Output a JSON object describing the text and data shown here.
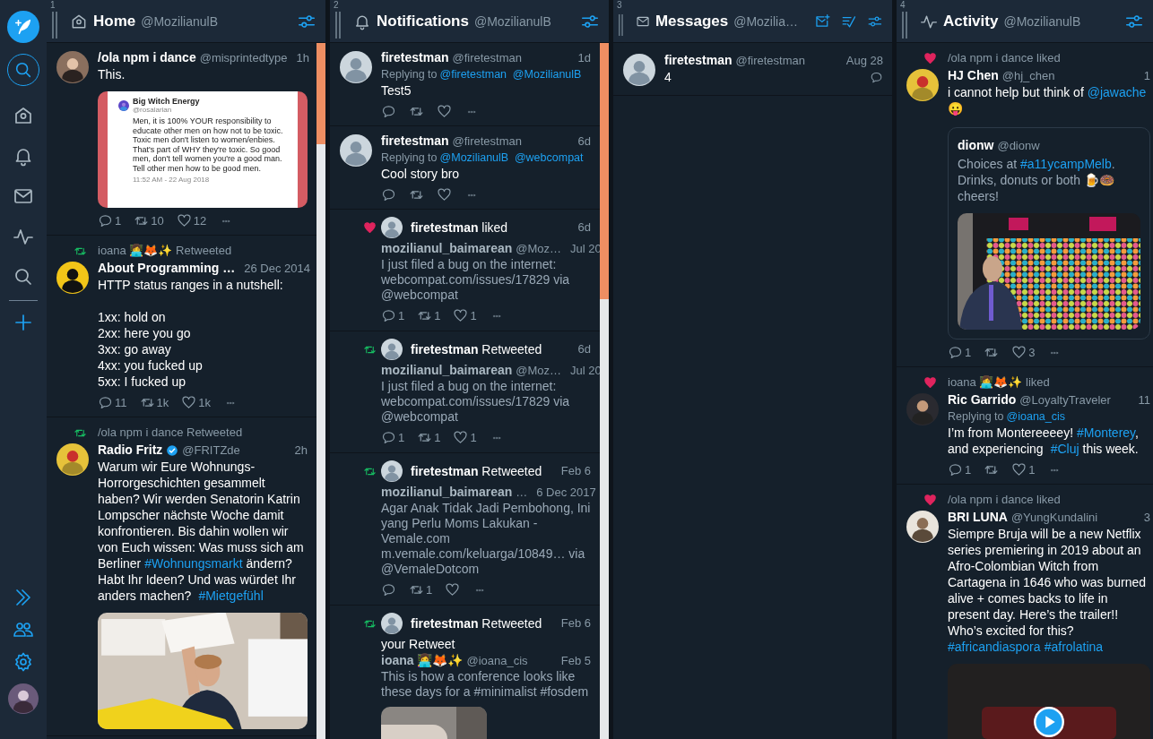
{
  "columns": [
    {
      "number": "1",
      "kind": "home",
      "title": "Home",
      "account": "@MozilianulB",
      "items": [
        {
          "kind": "tweet",
          "name": "/ola npm i dance",
          "handle": "@misprintedtype",
          "time": "1h",
          "verified": false,
          "text": [
            "This."
          ],
          "media": {
            "kind": "tweet_image",
            "author": "Big Witch Energy",
            "handle": "@rosalarian",
            "text": "Men, it is 100% YOUR responsibility to educate other men on how not to be toxic. Toxic men don't listen to women/enbies. That's part of WHY they're toxic. So good men, don't tell women you're a good man. Tell other men how to be good men.",
            "stamp": "11:52 AM - 22 Aug 2018"
          },
          "actions": {
            "replies": "1",
            "retweets": "10",
            "likes": "12"
          }
        },
        {
          "kind": "tweet",
          "context": {
            "kind": "retweet",
            "text": "ioana 👩‍💻🦊✨ Retweeted"
          },
          "name": "About Programming …",
          "time": "26 Dec 2014",
          "verified": false,
          "text": [
            "HTTP status ranges in a nutshell:\n\n1xx: hold on\n2xx: here you go\n3xx: go away\n4xx: you fucked up\n5xx: I fucked up"
          ],
          "actions": {
            "replies": "11",
            "retweets": "1k",
            "likes": "1k"
          }
        },
        {
          "kind": "tweet",
          "context": {
            "kind": "retweet",
            "text": "/ola npm i dance Retweeted"
          },
          "name": "Radio Fritz",
          "handle": "@FRITZde",
          "time": "2h",
          "verified": true,
          "text": [
            "Warum wir Eure Wohnungs-Horrorgeschichten gesammelt haben? Wir werden Senatorin Katrin Lompscher nächste Woche damit konfrontieren. Bis dahin wollen wir von Euch wissen: Was muss sich am Berliner ",
            {
              "link": "#Wohnungsmarkt"
            },
            " ändern? Habt Ihr Ideen? Und was würdet Ihr anders machen? ",
            {
              "link": "#Mietgefühl"
            }
          ],
          "media": {
            "kind": "picture"
          }
        }
      ]
    },
    {
      "number": "2",
      "kind": "notifications",
      "title": "Notifications",
      "account": "@MozilianulB",
      "items": [
        {
          "kind": "tweet",
          "name": "firetestman",
          "handle": "@firetestman",
          "time": "1d",
          "verified": false,
          "reply_to": {
            "label": "Replying to",
            "handles": [
              "@firetestman",
              "@MozilianulB"
            ]
          },
          "text": [
            "Test5"
          ],
          "actions": true
        },
        {
          "kind": "tweet",
          "name": "firetestman",
          "handle": "@firetestman",
          "time": "6d",
          "verified": false,
          "reply_to": {
            "label": "Replying to",
            "handles": [
              "@MozilianulB",
              "@webcompat"
            ]
          },
          "text": [
            "Cool story bro"
          ],
          "actions": true
        },
        {
          "kind": "like_activity",
          "text": "**firetestman** liked",
          "time": "6d",
          "embed": {
            "name": "mozilianul_baimarean",
            "handle": "@Moz…",
            "time": "Jul 20",
            "text": "I just filed a bug on the internet: webcompat.com/issues/17829 via @webcompat"
          },
          "actions": {
            "replies": "1",
            "retweets": "1",
            "likes": "1"
          }
        },
        {
          "kind": "retweet_activity",
          "text": "**firetestman** Retweeted",
          "time": "6d",
          "embed": {
            "name": "mozilianul_baimarean",
            "handle": "@Moz…",
            "time": "Jul 20",
            "text": "I just filed a bug on the internet: webcompat.com/issues/17829 via @webcompat"
          },
          "actions": {
            "replies": "1",
            "retweets": "1",
            "likes": "1"
          }
        },
        {
          "kind": "retweet_activity",
          "text": "**firetestman** Retweeted",
          "time": "Feb 6",
          "embed": {
            "name": "mozilianul_baimarean",
            "handle": "…",
            "time": "6 Dec 2017",
            "text": "Agar Anak Tidak Jadi Pembohong, Ini yang Perlu Moms Lakukan - Vemale.com m.vemale.com/keluarga/10849… via @VemaleDotcom"
          },
          "actions": {
            "retweets": "1"
          }
        },
        {
          "kind": "retweet_activity",
          "text": "**firetestman** Retweeted",
          "time": "Feb 6",
          "note": "your Retweet",
          "embed": {
            "name": "ioana 👩‍💻🦊✨",
            "handle": "@ioana_cis",
            "time": "Feb 5",
            "text": "This is how a conference looks like these days for a #minimalist #fosdem",
            "media": {
              "kind": "picture"
            }
          }
        }
      ]
    },
    {
      "number": "3",
      "kind": "messages",
      "title": "Messages",
      "account": "@Mozilia…",
      "items": [
        {
          "kind": "message",
          "name": "firetestman",
          "handle": "@firetestman",
          "time": "Aug 28",
          "text": "4"
        }
      ]
    },
    {
      "number": "4",
      "kind": "activity",
      "title": "Activity",
      "account": "@MozilianulB",
      "items": [
        {
          "kind": "tweet",
          "context": {
            "kind": "like",
            "text": "/ola npm i dance liked"
          },
          "name": "HJ Chen",
          "handle": "@hj_chen",
          "time": "1",
          "verified": false,
          "text": [
            "i cannot help but think of ",
            {
              "link": "@jawache"
            },
            " 😛"
          ],
          "quote": {
            "name": "dionw",
            "handle": "@dionw",
            "text": [
              "Choices at ",
              {
                "link": "#a11ycampMelb"
              },
              ". Drinks, donuts or both 🍺🍩 cheers!"
            ],
            "media": {
              "kind": "picture"
            }
          },
          "actions": {
            "replies": "1",
            "likes": "3"
          }
        },
        {
          "kind": "tweet",
          "context": {
            "kind": "like",
            "text": "ioana 👩‍💻🦊✨ liked"
          },
          "name": "Ric Garrido",
          "handle": "@LoyaltyTraveler",
          "time": "11",
          "verified": false,
          "reply_to": {
            "label": "Replying to",
            "handles": [
              "@ioana_cis"
            ]
          },
          "text": [
            "I’m from Montereeeey! ",
            {
              "link": "#Monterey"
            },
            ", and experiencing ",
            {
              "link": "#Cluj"
            },
            " this week."
          ],
          "actions": {
            "replies": "1",
            "likes": "1"
          }
        },
        {
          "kind": "tweet",
          "context": {
            "kind": "like",
            "text": "/ola npm i dance liked"
          },
          "name": "BRI LUNA",
          "handle": "@YungKundalini",
          "time": "3",
          "verified": false,
          "text": [
            "Siempre Bruja will be a new Netflix series premiering in 2019 about an Afro-Colombian Witch from Cartagena in 1646 who was burned alive + comes backs to life in present day. Here’s the trailer!! Who’s excited for this? ",
            {
              "link": "#africandiaspora"
            },
            {
              "link": "#afrolatina"
            }
          ],
          "media": {
            "kind": "video"
          }
        }
      ]
    }
  ]
}
